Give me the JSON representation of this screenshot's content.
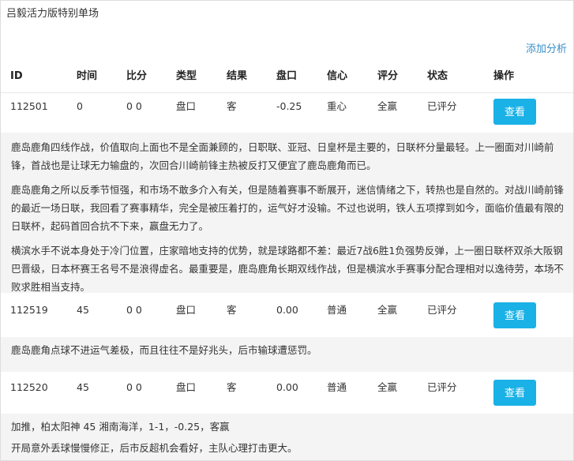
{
  "panel_title": "吕毅活力版特别单场",
  "add_analysis": "添加分析",
  "columns": [
    "ID",
    "时间",
    "比分",
    "类型",
    "结果",
    "盘口",
    "信心",
    "评分",
    "状态",
    "操作"
  ],
  "rows": [
    {
      "id": "112501",
      "time": "0",
      "score": "0 0",
      "type": "盘口",
      "result": "客",
      "line": "-0.25",
      "confidence": "重心",
      "rating": "全赢",
      "status": "已评分",
      "action": "查看",
      "analysis": [
        "鹿岛鹿角四线作战，价值取向上面也不是全面兼顾的，日职联、亚冠、日皇杯是主要的，日联杯分量最轻。上一圈面对川崎前锋，首战也是让球无力输盘的，次回合川崎前锋主热被反打又便宜了鹿岛鹿角而已。",
        "鹿岛鹿角之所以反季节恒强，和市场不敢多介入有关，但是随着赛事不断展开，迷信情绪之下，转热也是自然的。对战川崎前锋的最近一场日联，我回看了赛事精华，完全是被压着打的，运气好才没输。不过也说明，铁人五项撑到如今，面临价值最有限的日联杯，起码首回合抗不下来，赢盘无力了。",
        "横滨水手不说本身处于冷门位置，庄家暗地支持的优势，就是球路都不差：最近7战6胜1负强势反弹，上一圈日联杯双杀大阪钢巴晋级，日本杯赛王名号不是浪得虚名。最重要是，鹿岛鹿角长期双线作战，但是横滨水手赛事分配合理相对以逸待劳，本场不败求胜相当支持。"
      ]
    },
    {
      "id": "112519",
      "time": "45",
      "score": "0 0",
      "type": "盘口",
      "result": "客",
      "line": "0.00",
      "confidence": "普通",
      "rating": "全赢",
      "status": "已评分",
      "action": "查看",
      "analysis": [
        "鹿岛鹿角点球不进运气差极，而且往往不是好兆头，后市输球遭惩罚。"
      ]
    },
    {
      "id": "112520",
      "time": "45",
      "score": "0 0",
      "type": "盘口",
      "result": "客",
      "line": "0.00",
      "confidence": "普通",
      "rating": "全赢",
      "status": "已评分",
      "action": "查看",
      "analysis": [
        "加推，柏太阳神 45 湘南海洋，1-1，-0.25，客赢",
        "开局意外丢球慢慢修正，后市反超机会看好，主队心理打击更大。"
      ]
    }
  ]
}
